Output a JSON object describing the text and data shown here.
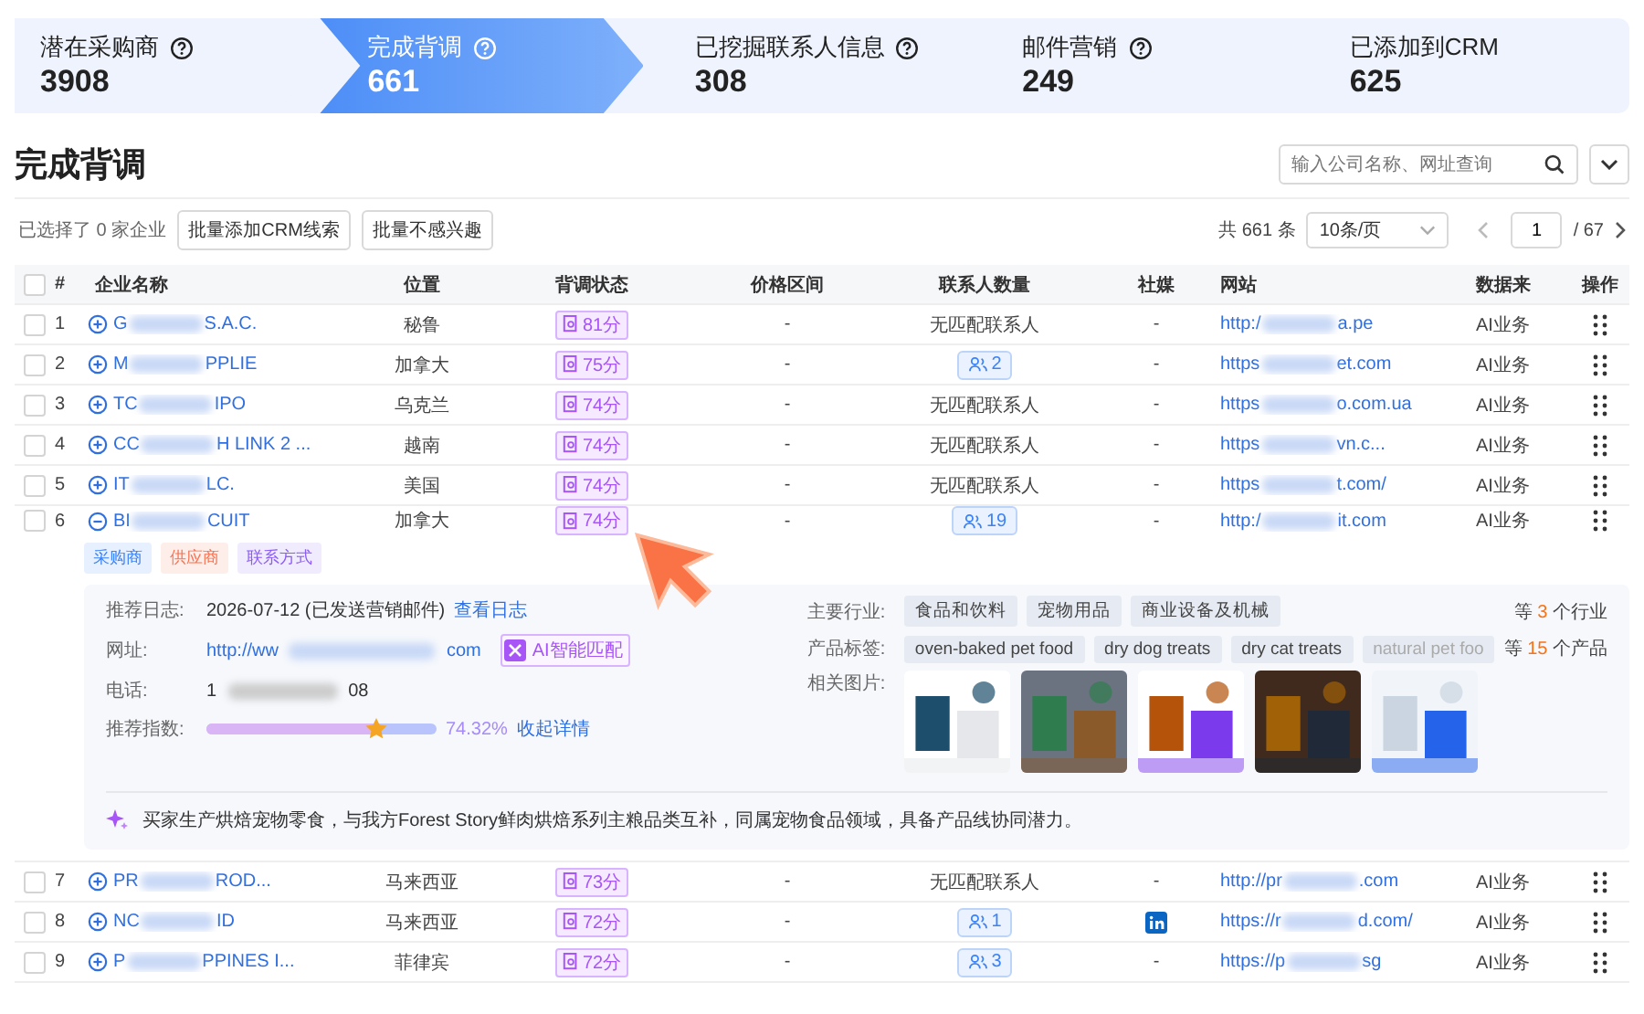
{
  "steps": [
    {
      "label": "潜在采购商",
      "count": "3908",
      "help": true,
      "selected": false
    },
    {
      "label": "完成背调",
      "count": "661",
      "help": true,
      "selected": true
    },
    {
      "label": "已挖掘联系人信息",
      "count": "308",
      "help": true,
      "selected": false
    },
    {
      "label": "邮件营销",
      "count": "249",
      "help": true,
      "selected": false
    },
    {
      "label": "已添加到CRM",
      "count": "625",
      "help": false,
      "selected": false
    }
  ],
  "page_title": "完成背调",
  "search": {
    "placeholder": "输入公司名称、网址查询"
  },
  "toolbar": {
    "selected_count": "已选择了 0 家企业",
    "buttons": [
      "批量添加CRM线索",
      "批量不感兴趣"
    ],
    "total": "共 661 条",
    "page_size": "10条/页",
    "page": "1",
    "pages": "/ 67"
  },
  "table": {
    "all_checked": false,
    "columns": [
      "#",
      "企业名称",
      "位置",
      "背调状态",
      "价格区间",
      "联系人数量",
      "社媒",
      "网站",
      "数据来",
      "操作"
    ],
    "rows": [
      {
        "checked": false,
        "index": "1",
        "name_head": "G",
        "name_tail": "S.A.C.",
        "expanded": false,
        "location": "秘鲁",
        "score": "81分",
        "price": "-",
        "contacts": {
          "kind": "none",
          "text": "无匹配联系人"
        },
        "social": {
          "kind": "text",
          "text": "-"
        },
        "site_head": "http:/",
        "site_tail": "a.pe",
        "source": "AI业务"
      },
      {
        "checked": false,
        "index": "2",
        "name_head": "M",
        "name_tail": "PPLIE",
        "expanded": false,
        "location": "加拿大",
        "score": "75分",
        "price": "-",
        "contacts": {
          "kind": "count",
          "text": "2"
        },
        "social": {
          "kind": "text",
          "text": "-"
        },
        "site_head": "https",
        "site_tail": "et.com",
        "source": "AI业务"
      },
      {
        "checked": false,
        "index": "3",
        "name_head": "TC",
        "name_tail": "IPO",
        "expanded": false,
        "location": "乌克兰",
        "score": "74分",
        "price": "-",
        "contacts": {
          "kind": "none",
          "text": "无匹配联系人"
        },
        "social": {
          "kind": "text",
          "text": "-"
        },
        "site_head": "https",
        "site_tail": "o.com.ua",
        "source": "AI业务"
      },
      {
        "checked": false,
        "index": "4",
        "name_head": "CC",
        "name_tail": "H LINK 2 ...",
        "expanded": false,
        "location": "越南",
        "score": "74分",
        "price": "-",
        "contacts": {
          "kind": "none",
          "text": "无匹配联系人"
        },
        "social": {
          "kind": "text",
          "text": "-"
        },
        "site_head": "https",
        "site_tail": "vn.c...",
        "source": "AI业务"
      },
      {
        "checked": false,
        "index": "5",
        "name_head": "IT",
        "name_tail": "LC.",
        "expanded": false,
        "location": "美国",
        "score": "74分",
        "price": "-",
        "contacts": {
          "kind": "none",
          "text": "无匹配联系人"
        },
        "social": {
          "kind": "text",
          "text": "-"
        },
        "site_head": "https",
        "site_tail": "t.com/",
        "source": "AI业务"
      },
      {
        "checked": false,
        "index": "6",
        "name_head": "BI",
        "name_tail": "CUIT",
        "expanded": true,
        "location": "加拿大",
        "score": "74分",
        "price": "-",
        "contacts": {
          "kind": "count",
          "text": "19"
        },
        "social": {
          "kind": "text",
          "text": "-"
        },
        "site_head": "http:/",
        "site_tail": "it.com",
        "source": "AI业务",
        "tags": [
          {
            "label": "采购商",
            "color": "#3b82f6"
          },
          {
            "label": "供应商",
            "color": "#f97352"
          },
          {
            "label": "联系方式",
            "color": "#8b5cf6"
          }
        ],
        "detail": {
          "log_label": "推荐日志:",
          "log_text": "2026-07-12 (已发送营销邮件)",
          "log_link": "查看日志",
          "url_label": "网址:",
          "url_head": "http://ww",
          "url_tail": "com",
          "ai_badge": "AI智能匹配",
          "phone_label": "电话:",
          "phone_head": "1",
          "phone_tail": "08",
          "index_label": "推荐指数:",
          "level": 0.74,
          "percent": "74.32%",
          "collapse_link": "收起详情",
          "industry_label": "主要行业:",
          "industries": [
            "食品和饮料",
            "宠物用品",
            "商业设备及机械"
          ],
          "industry_more": {
            "prefix": "等",
            "count": "3",
            "suffix": "个行业"
          },
          "product_label": "产品标签:",
          "products": [
            "oven-baked pet food",
            "dry dog treats",
            "dry cat treats",
            "natural pet foo"
          ],
          "product_more": {
            "prefix": "等",
            "count": "15",
            "suffix": "个产品"
          },
          "images_label": "相关图片:",
          "images": [
            {
              "kind": "picture"
            },
            {
              "kind": "picture"
            },
            {
              "kind": "picture"
            },
            {
              "kind": "picture"
            },
            {
              "kind": "picture"
            }
          ],
          "summary": "买家生产烘焙宠物零食，与我方Forest Story鲜肉烘焙系列主粮品类互补，同属宠物食品领域，具备产品线协同潜力。"
        }
      },
      {
        "checked": false,
        "index": "7",
        "name_head": "PR",
        "name_tail": "ROD...",
        "expanded": false,
        "location": "马来西亚",
        "score": "73分",
        "price": "-",
        "contacts": {
          "kind": "none",
          "text": "无匹配联系人"
        },
        "social": {
          "kind": "text",
          "text": "-"
        },
        "site_head": "http://pr",
        "site_tail": ".com",
        "source": "AI业务"
      },
      {
        "checked": false,
        "index": "8",
        "name_head": "NC",
        "name_tail": "ID",
        "expanded": false,
        "location": "马来西亚",
        "score": "72分",
        "price": "-",
        "contacts": {
          "kind": "count",
          "text": "1"
        },
        "social": {
          "kind": "linkedin"
        },
        "site_head": "https://r",
        "site_tail": "d.com/",
        "source": "AI业务"
      },
      {
        "checked": false,
        "index": "9",
        "name_head": "P",
        "name_tail": "PPINES I...",
        "expanded": false,
        "location": "菲律宾",
        "score": "72分",
        "price": "-",
        "contacts": {
          "kind": "count",
          "text": "3"
        },
        "social": {
          "kind": "text",
          "text": "-"
        },
        "site_head": "https://p",
        "site_tail": "sg",
        "source": "AI业务"
      }
    ]
  }
}
